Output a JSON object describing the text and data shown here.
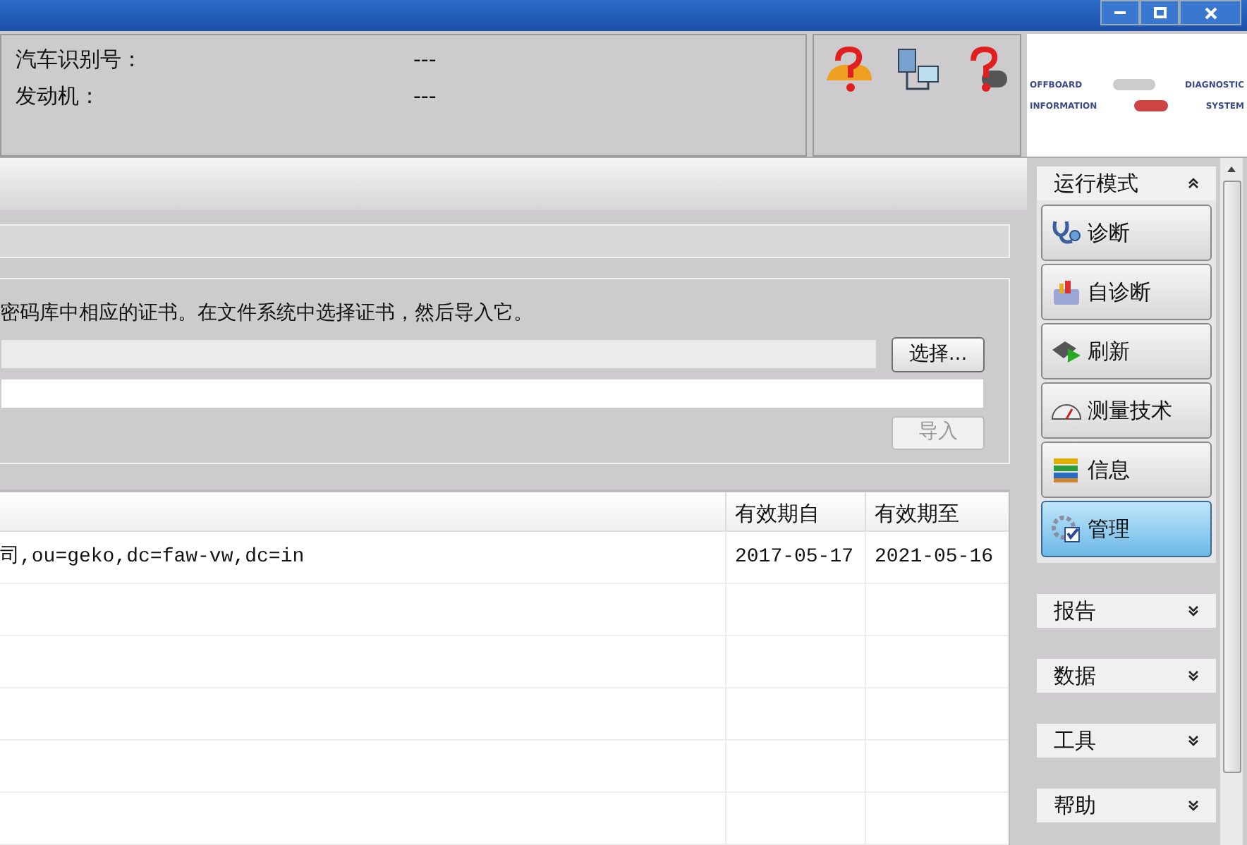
{
  "vehicle_info": [
    {
      "label": "汽车识别号：",
      "value": "---"
    },
    {
      "label": "发动机：",
      "value": "---"
    }
  ],
  "logo": {
    "words": [
      "OFFBOARD",
      "DIAGNOSTIC",
      "INFORMATION",
      "SYSTEM"
    ]
  },
  "certificate_import": {
    "description": "密码库中相应的证书。在文件系统中选择证书，然后导入它。",
    "select_button": "选择...",
    "import_button": {
      "label": "导入",
      "disabled": true
    }
  },
  "table": {
    "columns": [
      "有效期自",
      "有效期至"
    ],
    "rows": [
      {
        "column_1": "司,ou=geko,dc=faw-vw,dc=in",
        "valid_from": "2017-05-17",
        "valid_to": "2021-05-16"
      }
    ]
  },
  "sidebar": {
    "sections": [
      {
        "title": "运行模式",
        "expanded": true,
        "items": [
          {
            "label": "诊断",
            "selected": false
          },
          {
            "label": "自诊断",
            "selected": false
          },
          {
            "label": "刷新",
            "selected": false
          },
          {
            "label": "测量技术",
            "selected": false
          },
          {
            "label": "信息",
            "selected": false
          },
          {
            "label": "管理",
            "selected": true
          }
        ]
      },
      {
        "title": "报告",
        "expanded": false
      },
      {
        "title": "数据",
        "expanded": false
      },
      {
        "title": "工具",
        "expanded": false
      },
      {
        "title": "帮助",
        "expanded": false
      }
    ]
  }
}
